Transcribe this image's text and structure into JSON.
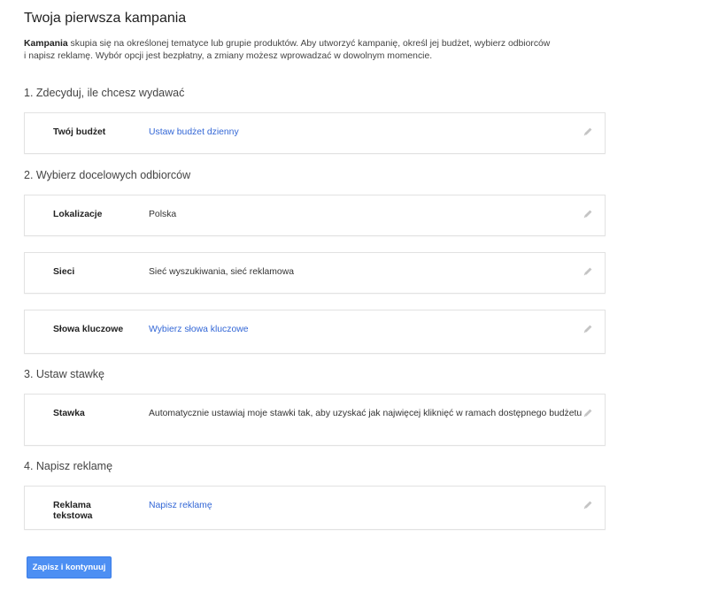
{
  "page": {
    "title": "Twoja pierwsza kampania",
    "intro_bold": "Kampania",
    "intro_line1": " skupia się na określonej tematyce lub grupie produktów. Aby utworzyć kampanię, określ jej budżet, wybierz odbiorców",
    "intro_line2": "i napisz reklamę. Wybór opcji jest bezpłatny, a zmiany możesz wprowadzać w dowolnym momencie."
  },
  "sections": [
    {
      "heading": "1. Zdecyduj, ile chcesz wydawać",
      "cards": [
        {
          "label": "Twój budżet",
          "value": "Ustaw budżet dzienny",
          "is_link": true
        }
      ]
    },
    {
      "heading": "2. Wybierz docelowych odbiorców",
      "cards": [
        {
          "label": "Lokalizacje",
          "value": "Polska",
          "is_link": false
        },
        {
          "label": "Sieci",
          "value": "Sieć wyszukiwania, sieć reklamowa",
          "is_link": false
        },
        {
          "label": "Słowa kluczowe",
          "value": "Wybierz słowa kluczowe",
          "is_link": true
        }
      ]
    },
    {
      "heading": "3. Ustaw stawkę",
      "cards": [
        {
          "label": "Stawka",
          "value": "Automatycznie ustawiaj moje stawki tak, aby uzyskać jak najwięcej kliknięć w ramach dostępnego budżetu",
          "is_link": false
        }
      ]
    },
    {
      "heading": "4. Napisz reklamę",
      "cards": [
        {
          "label": "Reklama tekstowa",
          "value": "Napisz reklamę",
          "is_link": true
        }
      ]
    }
  ],
  "actions": {
    "save_label": "Zapisz i kontynuuj"
  },
  "icons": {
    "edit": "pencil-icon"
  },
  "colors": {
    "link": "#3367d6",
    "button": "#4d8ff3",
    "icon": "#c4c4c4"
  }
}
